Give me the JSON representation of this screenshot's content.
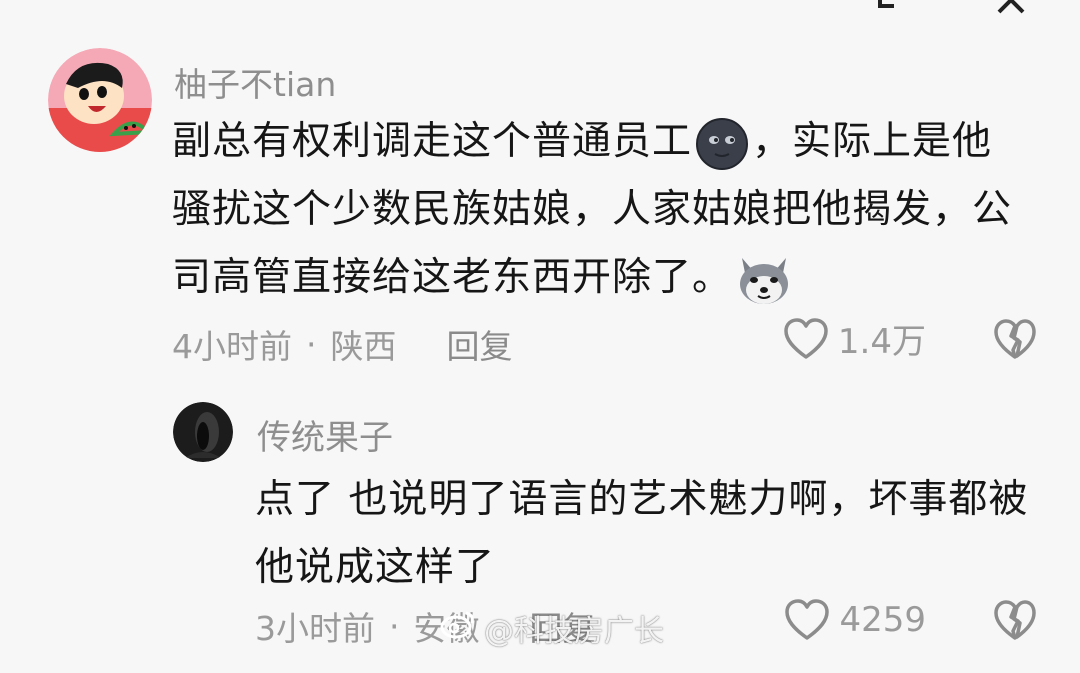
{
  "top_bar": {
    "icons": [
      "fullscreen-icon",
      "close-icon"
    ]
  },
  "comment": {
    "user_name": "柚子不tian",
    "text_part1": "副总有权利调走这个普通员工",
    "emoji1": "dark-moon-face-emoji",
    "text_part2": "，实际上是他骚扰这个少数民族姑娘，人家姑娘把他揭发，公司高管直接给这老东西开除了。",
    "emoji2": "husky-dog-emoji",
    "time": "4小时前",
    "separator": "·",
    "location": "陕西",
    "reply_label": "回复",
    "like_count": "1.4万"
  },
  "reply": {
    "user_name": "传统果子",
    "text": "点了 也说明了语言的艺术魅力啊，坏事都被他说成这样了",
    "time": "3小时前",
    "separator": "·",
    "location": "安徽",
    "reply_label": "回复",
    "like_count": "4259"
  },
  "watermark": {
    "text": "@科技房广长"
  }
}
